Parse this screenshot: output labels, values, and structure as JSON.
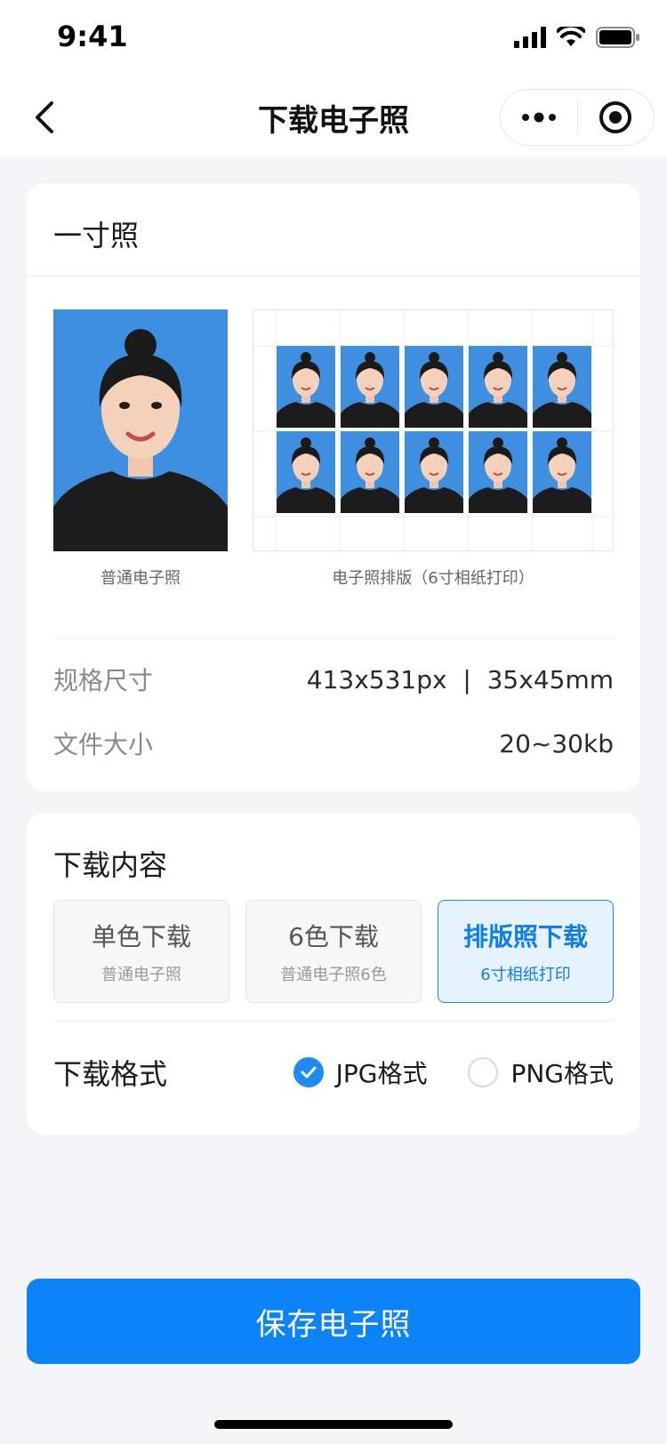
{
  "status_bar": {
    "time": "9:41"
  },
  "nav": {
    "title": "下载电子照"
  },
  "photo_card": {
    "title": "一寸照",
    "single_caption": "普通电子照",
    "layout_caption": "电子照排版（6寸相纸打印）",
    "specs": [
      {
        "label": "规格尺寸",
        "value": "413x531px  |  35x45mm"
      },
      {
        "label": "文件大小",
        "value": "20~30kb"
      }
    ]
  },
  "download_card": {
    "title": "下载内容",
    "options": [
      {
        "title": "单色下载",
        "subtitle": "普通电子照",
        "selected": false
      },
      {
        "title": "6色下载",
        "subtitle": "普通电子照6色",
        "selected": false
      },
      {
        "title": "排版照下载",
        "subtitle": "6寸相纸打印",
        "selected": true
      }
    ],
    "format_label": "下载格式",
    "formats": [
      {
        "label": "JPG格式",
        "checked": true
      },
      {
        "label": "PNG格式",
        "checked": false
      }
    ]
  },
  "save_button": "保存电子照",
  "colors": {
    "accent": "#0a84f7",
    "photo_bg": "#3f8fe0",
    "selected_bg": "#e6f3fe"
  }
}
